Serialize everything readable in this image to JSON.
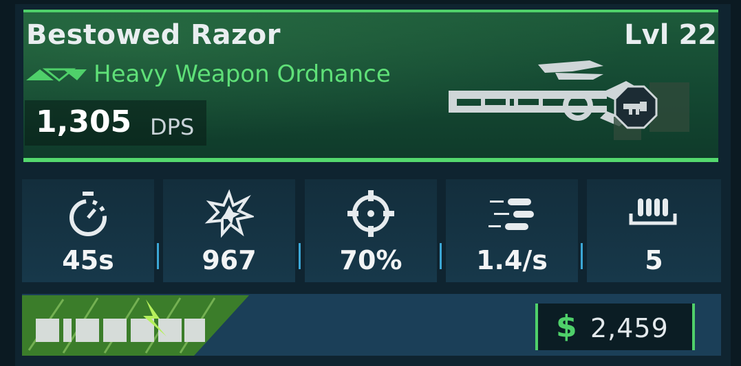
{
  "item": {
    "name": "Bestowed Razor",
    "level": "Lvl 22",
    "type": "Heavy Weapon Ordnance",
    "dps_value": "1,305",
    "dps_unit": "DPS"
  },
  "stats": [
    {
      "icon": "stopwatch-icon",
      "value": "45s"
    },
    {
      "icon": "explosion-icon",
      "value": "967"
    },
    {
      "icon": "crosshair-icon",
      "value": "70%"
    },
    {
      "icon": "bullets-firerate-icon",
      "value": "1.4/s"
    },
    {
      "icon": "magazine-icon",
      "value": "5"
    }
  ],
  "manufacturer": {
    "logo": "Ripper",
    "icon": "ripper-logo-icon"
  },
  "price": {
    "currency": "$",
    "value": "2,459"
  },
  "colors": {
    "accent_green": "#4fd06a",
    "type_green": "#5fe078",
    "divider_blue": "#3ba7d6",
    "panel_dark": "#0f2430"
  }
}
